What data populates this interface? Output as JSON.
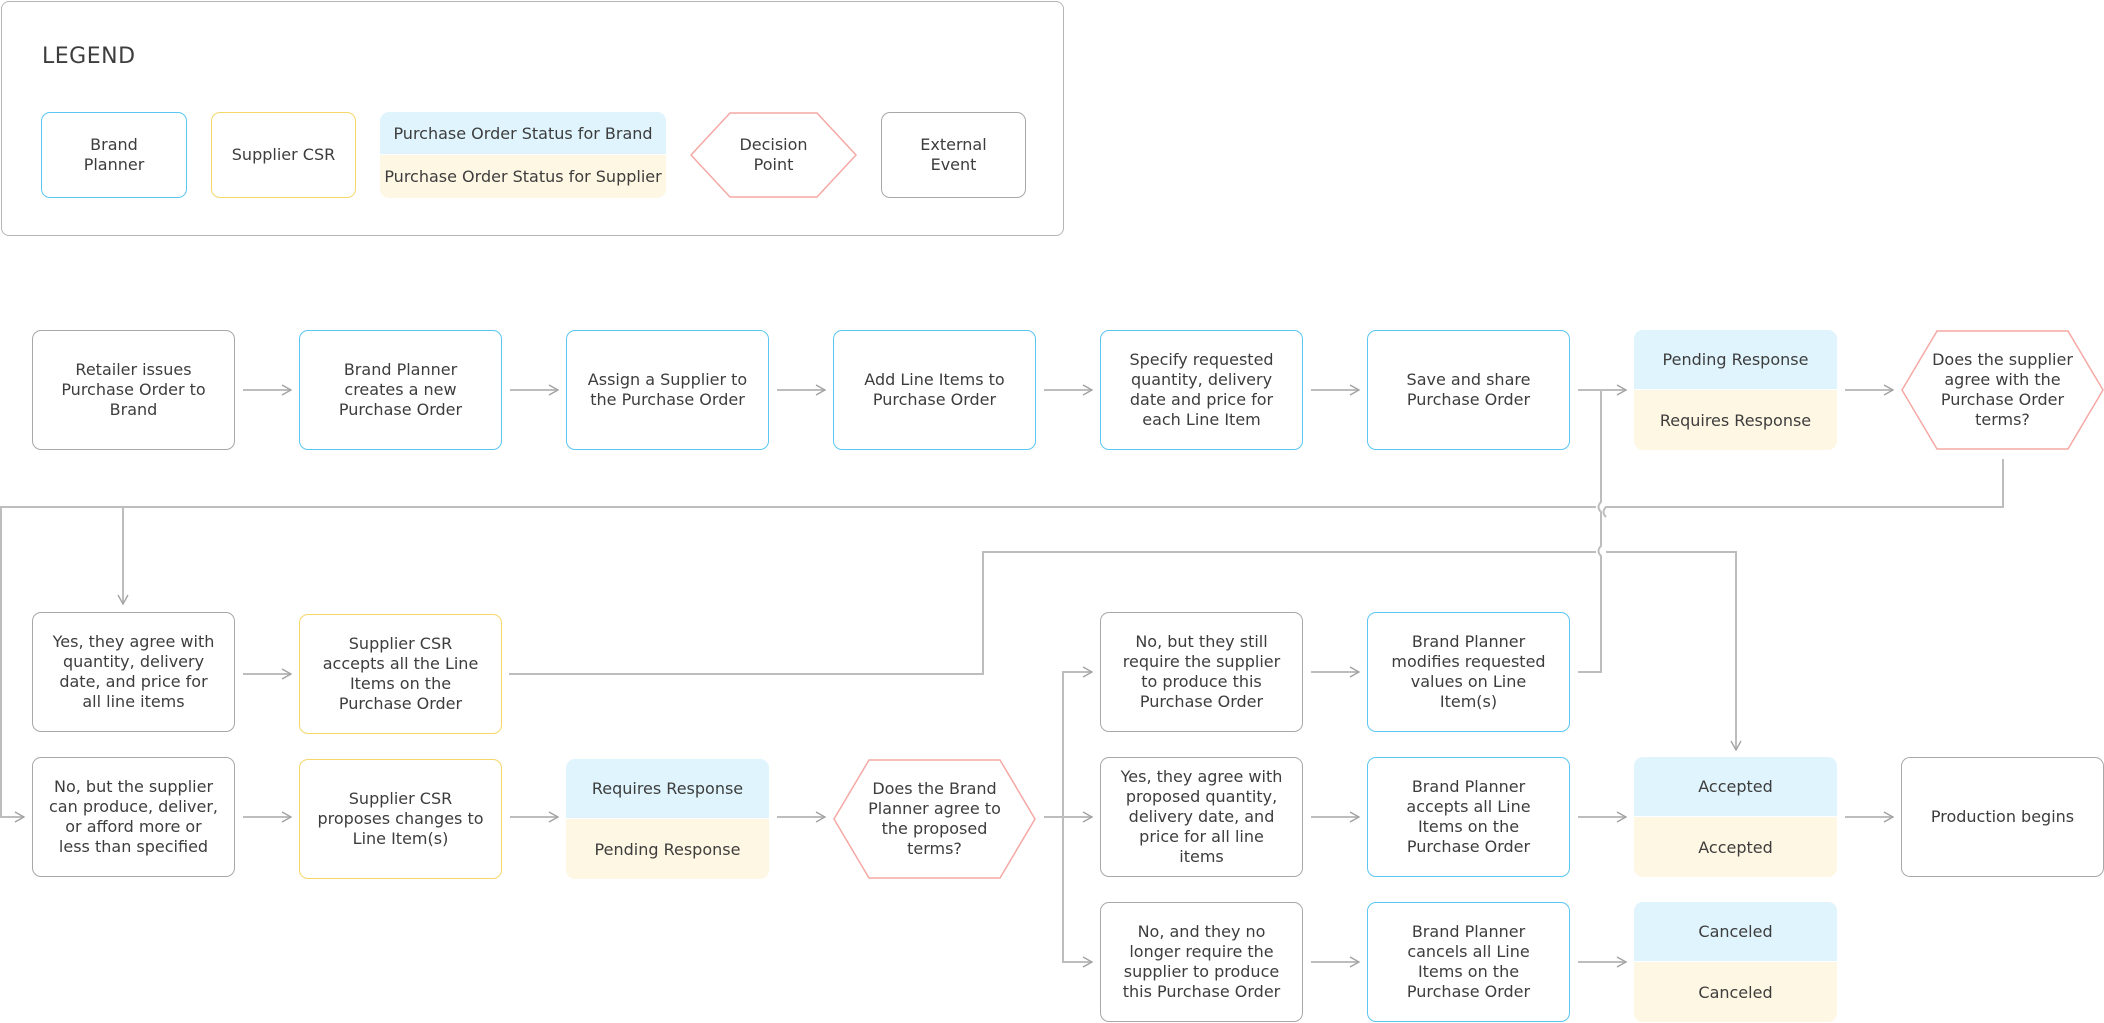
{
  "legend": {
    "title": "LEGEND",
    "brand_planner": "Brand Planner",
    "supplier_csr": "Supplier CSR",
    "status_brand": "Purchase Order Status for Brand",
    "status_supplier": "Purchase Order Status for Supplier",
    "decision_point": "Decision Point",
    "external_event": "External Event"
  },
  "colors": {
    "brand_border": "#5cc6f2",
    "supplier_border": "#f5d66b",
    "status_brand_bg": "#dff4fd",
    "status_supplier_bg": "#fef7e3",
    "decision_border": "#f5a8a4",
    "external_border": "#a8a8a8",
    "connector": "#bdbdbd"
  },
  "row1": {
    "retailer_issues": "Retailer issues Purchase Order to Brand",
    "brand_creates": "Brand Planner creates a new Purchase Order",
    "assign_supplier": "Assign a Supplier to the Purchase Order",
    "add_line_items": "Add Line Items to Purchase Order",
    "specify_values": "Specify requested quantity, delivery date and price for each Line Item",
    "save_share": "Save and share Purchase Order",
    "status1_brand": "Pending Response",
    "status1_supplier": "Requires Response",
    "decision1": "Does the supplier agree with the Purchase Order terms?"
  },
  "supplier_yes": {
    "condition": "Yes, they agree with quantity, delivery date, and price for all line items",
    "action": "Supplier CSR  accepts all the Line Items on the Purchase Order"
  },
  "supplier_no": {
    "condition": "No, but the supplier can produce, deliver, or afford more or less than specified",
    "action": "Supplier CSR proposes changes to Line Item(s)",
    "status_brand": "Requires Response",
    "status_supplier": "Pending Response",
    "decision2": "Does the Brand Planner agree to the proposed terms?"
  },
  "brand_modify": {
    "condition": "No, but they still require the supplier to produce this Purchase Order",
    "action": "Brand Planner modifies requested values on Line Item(s)"
  },
  "brand_accept": {
    "condition": "Yes, they agree with proposed quantity, delivery date, and price for all line items",
    "action": "Brand Planner accepts all Line Items on the Purchase Order",
    "status_brand": "Accepted",
    "status_supplier": "Accepted",
    "final": "Production begins"
  },
  "brand_cancel": {
    "condition": "No, and they no longer require the supplier to produce this Purchase Order",
    "action": "Brand Planner cancels all Line Items on the Purchase Order",
    "status_brand": "Canceled",
    "status_supplier": "Canceled"
  }
}
